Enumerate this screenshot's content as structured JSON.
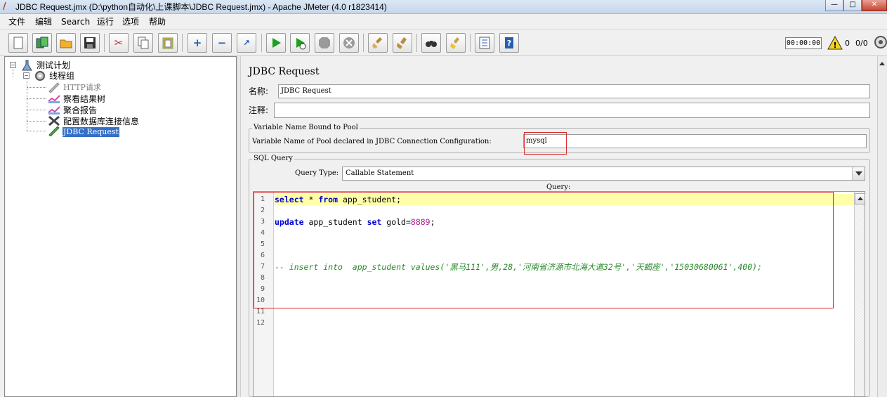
{
  "window": {
    "title": "JDBC Request.jmx (D:\\python自动化\\上课脚本\\JDBC Request.jmx) - Apache JMeter (4.0 r1823414)",
    "minimize": "—",
    "maximize": "□",
    "close": "✕"
  },
  "menu": [
    "文件",
    "编辑",
    "Search",
    "运行",
    "选项",
    "帮助"
  ],
  "toolbar": {
    "timer": "00:00:00",
    "warning_count": "0",
    "thread_count": "0/0"
  },
  "tree": {
    "root": "测试计划",
    "thread_group": "线程组",
    "children": [
      "HTTP请求",
      "察看结果树",
      "聚合报告",
      "配置数据库连接信息",
      "JDBC Request"
    ]
  },
  "panel": {
    "title": "JDBC Request",
    "name_label": "名称:",
    "name_value": "JDBC Request",
    "comment_label": "注释:",
    "comment_value": "",
    "pool_group_title": "Variable Name Bound to Pool",
    "pool_label": "Variable Name of Pool declared in JDBC Connection Configuration:",
    "pool_value": "mysql",
    "sql_group_title": "SQL Query",
    "query_type_label": "Query Type:",
    "query_type_value": "Callable Statement",
    "query_label": "Query:"
  },
  "code": {
    "line_numbers": [
      "1",
      "2",
      "3",
      "4",
      "5",
      "6",
      "7",
      "8",
      "9",
      "10",
      "11",
      "12"
    ],
    "line1": {
      "kw1": "select",
      "t1": " * ",
      "kw2": "from",
      "t2": " app_student;"
    },
    "line3": {
      "kw1": "update",
      "t1": " app_student ",
      "kw2": "set",
      "t2": " gold=",
      "num": "8889",
      "t3": ";"
    },
    "line7": "-- insert into  app_student values('黑马111',男,28,'河南省济源市北海大道32号','天蝎座','15030680061',400);"
  },
  "colors": {
    "accent_selected": "#3470c6",
    "annotation": "#d42a2a",
    "highlight_line": "#ffffaa"
  }
}
